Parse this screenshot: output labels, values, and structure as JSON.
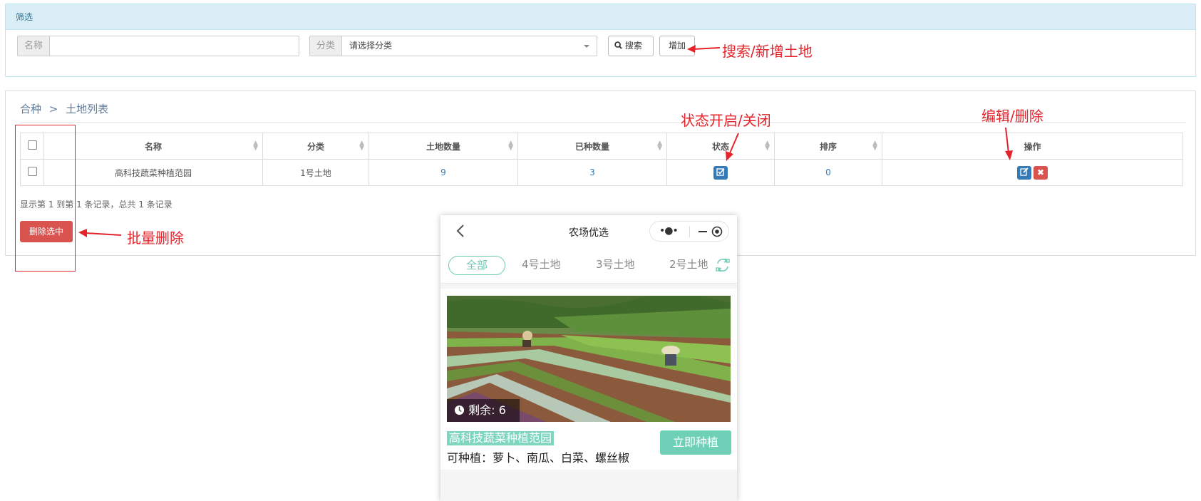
{
  "filter": {
    "title": "筛选",
    "name_label": "名称",
    "name_value": "",
    "category_label": "分类",
    "category_value": "请选择分类",
    "search_label": "搜索",
    "add_label": "增加"
  },
  "breadcrumb": {
    "root": "合种",
    "separator": ">",
    "current": "土地列表"
  },
  "table": {
    "columns": [
      "名称",
      "分类",
      "土地数量",
      "已种数量",
      "状态",
      "排序",
      "操作"
    ],
    "rows": [
      {
        "name": "高科技蔬菜种植范园",
        "category": "1号土地",
        "land_count": "9",
        "planted_count": "3",
        "status": "enabled",
        "sort": "0"
      }
    ]
  },
  "summary": "显示第 1 到第 1 条记录，总共 1 条记录",
  "delete_selected_label": "删除选中",
  "annotations": {
    "search_add": "搜索/新增土地",
    "status_toggle": "状态开启/关闭",
    "edit_delete": "编辑/删除",
    "batch_delete": "批量删除",
    "color": "#e5232b"
  },
  "mobile": {
    "title": "农场优选",
    "tabs": [
      "全部",
      "4号土地",
      "3号土地",
      "2号土地"
    ],
    "active_tab": "全部",
    "remaining_label": "剩余:",
    "remaining_value": "6",
    "farm_name": "高科技蔬菜种植范园",
    "crops": "可种植：萝卜、南瓜、白菜、螺丝椒",
    "plant_button": "立即种植",
    "accent_color": "#6cc9b2"
  }
}
